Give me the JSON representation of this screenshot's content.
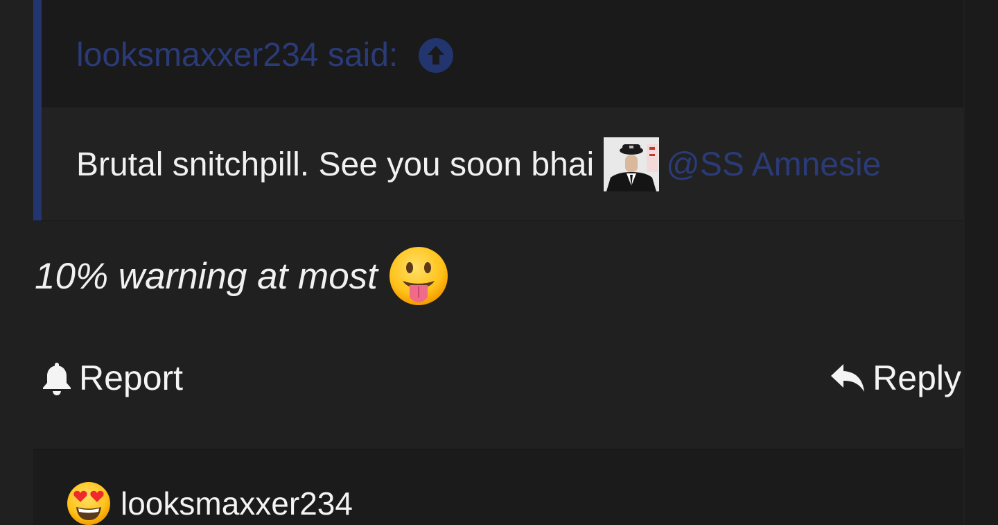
{
  "quote": {
    "author_said": "looksmaxxer234 said:",
    "text": "Brutal snitchpill. See you soon bhai",
    "mention": "@SS Amnesie",
    "jump_icon": "arrow-up-circle-icon",
    "inline_image": "uniformed-man-image"
  },
  "post": {
    "message": "10% warning at most",
    "emoji": "face-with-tongue-emoji"
  },
  "actions": {
    "report_label": "Report",
    "report_icon": "bell-icon",
    "reply_label": "Reply",
    "reply_icon": "reply-arrow-icon"
  },
  "next_post": {
    "author": "looksmaxxer234",
    "avatar_emoji": "heart-eyes-emoji"
  },
  "colors": {
    "background": "#202020",
    "quote_bar": "#22356e",
    "link": "#2a3b78",
    "text": "#f1f1f1"
  }
}
